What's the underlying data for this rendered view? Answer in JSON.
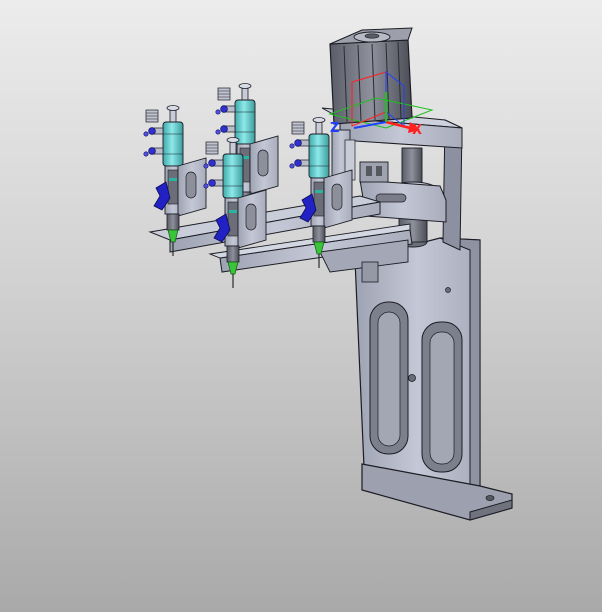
{
  "viewer": {
    "background_top": "#ececec",
    "background_bottom": "#a9a9a9"
  },
  "model": {
    "part_color": "#b3b7c6",
    "edge_color": "#1c1c24",
    "cylinder_color": "#5fcfcf",
    "clamp_color": "#2020c0",
    "needle_color": "#39c439",
    "dispenser_count": 3
  },
  "axis_triad": {
    "x_label": "X",
    "y_label": "Y",
    "z_label": "Z",
    "x_color": "#ff2020",
    "y_color": "#20c020",
    "z_color": "#2040ff"
  }
}
